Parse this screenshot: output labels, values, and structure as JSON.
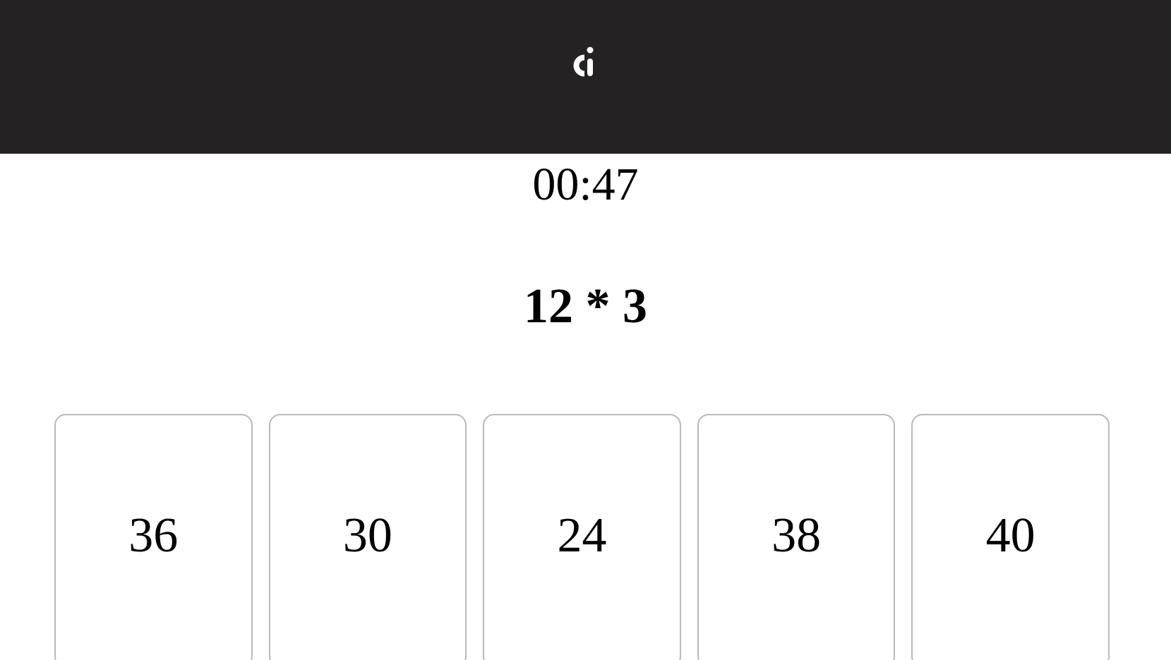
{
  "header": {
    "logo_icon": "ci-logo-icon",
    "background": "#252223"
  },
  "quiz": {
    "timer": "00:47",
    "question": "12 * 3",
    "answers": [
      {
        "label": "36"
      },
      {
        "label": "30"
      },
      {
        "label": "24"
      },
      {
        "label": "38"
      },
      {
        "label": "40"
      }
    ]
  },
  "colors": {
    "card_border": "#b9b9b9",
    "text": "#000000",
    "logo": "#ffffff"
  }
}
